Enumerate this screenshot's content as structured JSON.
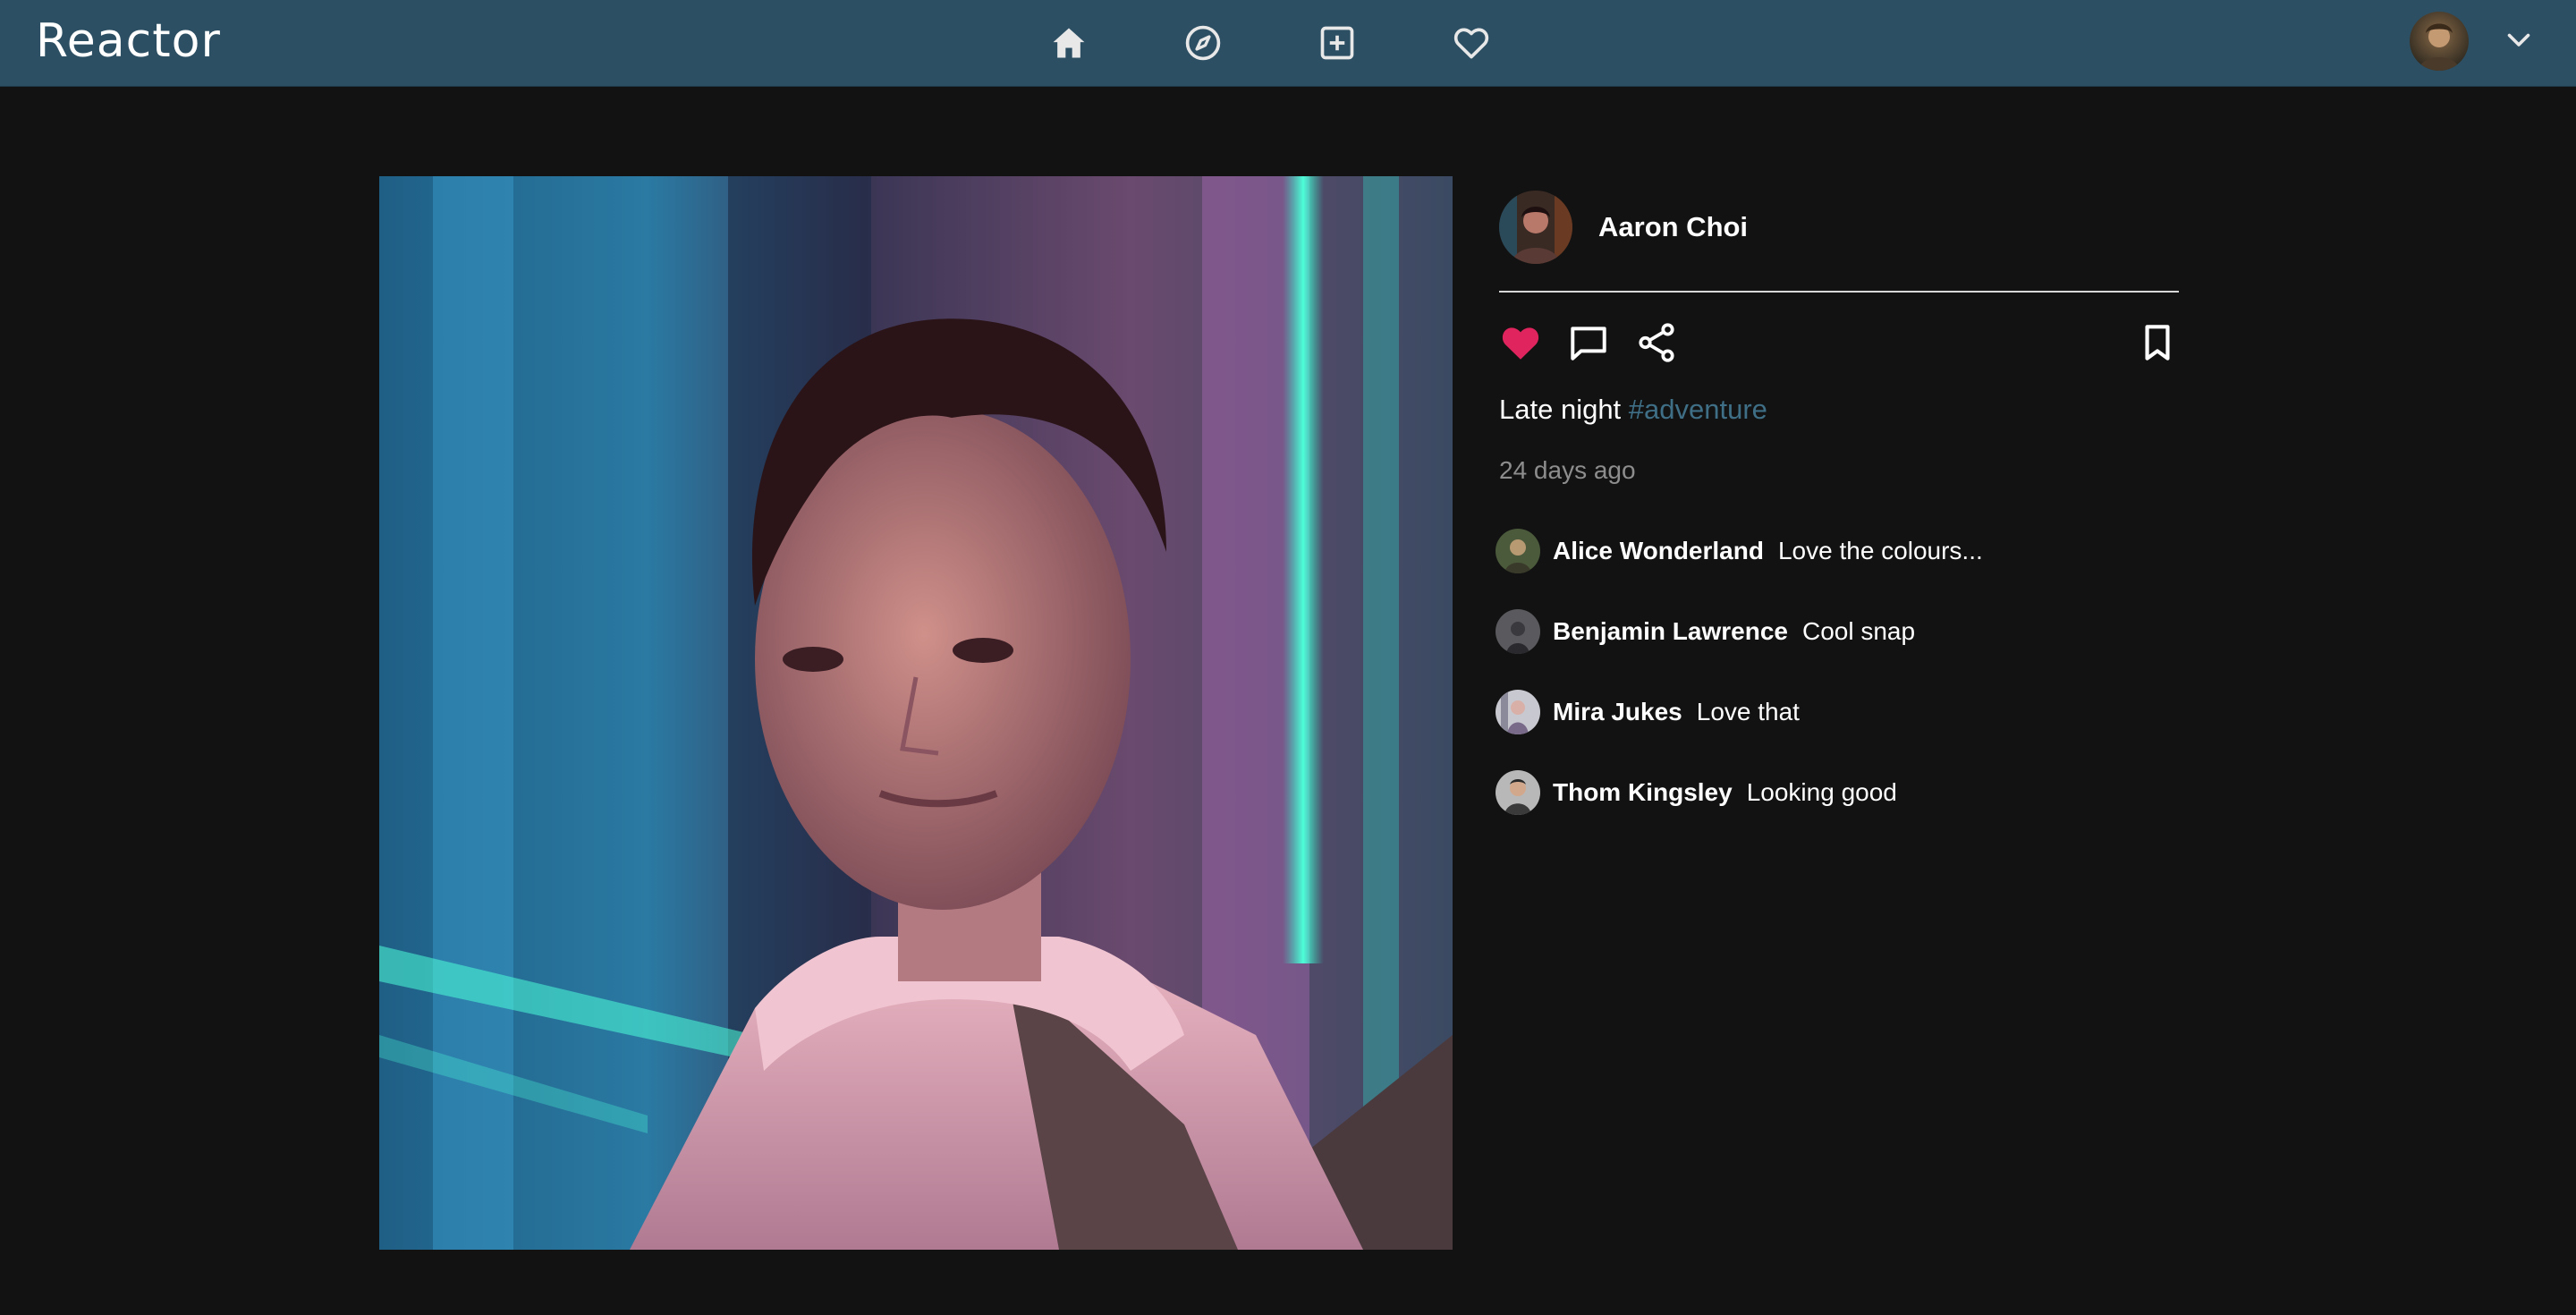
{
  "app": {
    "name": "Reactor"
  },
  "nav": {
    "icons": [
      "home-icon",
      "explore-compass-icon",
      "add-post-icon",
      "heart-icon"
    ],
    "account_menu_icon": "chevron-down-icon"
  },
  "post": {
    "author": "Aaron Choi",
    "caption_text": "Late night",
    "hashtag": "#adventure",
    "timestamp": "24 days ago",
    "liked": true,
    "actions": [
      "heart-icon",
      "comment-icon",
      "share-icon",
      "bookmark-icon"
    ]
  },
  "comments": [
    {
      "user": "Alice Wonderland",
      "text": "Love the colours..."
    },
    {
      "user": "Benjamin Lawrence",
      "text": "Cool snap"
    },
    {
      "user": "Mira Jukes",
      "text": "Love that"
    },
    {
      "user": "Thom Kingsley",
      "text": "Looking good"
    }
  ],
  "colors": {
    "topbar": "#2c4f63",
    "background": "#121212",
    "like_active": "#e0245e",
    "hashtag": "#3f6f86",
    "muted_text": "#8d8d8d"
  }
}
